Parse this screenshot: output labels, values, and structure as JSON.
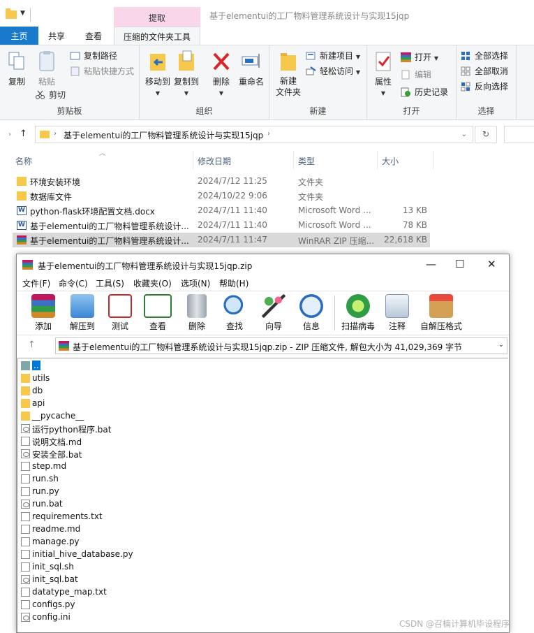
{
  "explorer": {
    "window_title": "基于elementui的工厂物料管理系统设计与实现15jqp",
    "context_tab": "提取",
    "tabs": [
      "主页",
      "共享",
      "查看",
      "压缩的文件夹工具"
    ],
    "ribbon": {
      "clipboard": {
        "label": "剪贴板",
        "copy": "复制",
        "paste": "粘贴",
        "copy_path": "复制路径",
        "paste_shortcut": "粘贴快捷方式",
        "cut": "剪切"
      },
      "organize": {
        "label": "组织",
        "move_to": "移动到",
        "copy_to": "复制到",
        "delete": "删除",
        "rename": "重命名"
      },
      "new": {
        "label": "新建",
        "new_folder": "新建\n文件夹",
        "new_item": "新建项目",
        "easy_access": "轻松访问"
      },
      "open": {
        "label": "打开",
        "properties": "属性",
        "open": "打开",
        "edit": "编辑",
        "history": "历史记录"
      },
      "select": {
        "label": "选择",
        "select_all": "全部选择",
        "select_none": "全部取消",
        "invert": "反向选择"
      }
    },
    "address": "基于elementui的工厂物料管理系统设计与实现15jqp",
    "columns": {
      "name": "名称",
      "date": "修改日期",
      "type": "类型",
      "size": "大小"
    },
    "files": [
      {
        "name": "环境安装环境",
        "date": "2024/7/12 11:25",
        "type": "文件夹",
        "size": "",
        "icon": "folder-icon"
      },
      {
        "name": "数据库文件",
        "date": "2024/10/22 9:06",
        "type": "文件夹",
        "size": "",
        "icon": "folder-icon"
      },
      {
        "name": "python-flask环境配置文档.docx",
        "date": "2024/7/11 11:40",
        "type": "Microsoft Word ...",
        "size": "13 KB",
        "icon": "word-icon"
      },
      {
        "name": "基于elementui的工厂物料管理系统设计...",
        "date": "2024/7/11 11:40",
        "type": "Microsoft Word ...",
        "size": "78 KB",
        "icon": "word-icon"
      },
      {
        "name": "基于elementui的工厂物料管理系统设计...",
        "date": "2024/7/11 11:47",
        "type": "WinRAR ZIP 压缩...",
        "size": "22,618 KB",
        "icon": "winrar-icon",
        "selected": true
      }
    ]
  },
  "winrar": {
    "title": "基于elementui的工厂物料管理系统设计与实现15jqp.zip",
    "menu": [
      "文件(F)",
      "命令(C)",
      "工具(S)",
      "收藏夹(O)",
      "选项(N)",
      "帮助(H)"
    ],
    "toolbar": [
      "添加",
      "解压到",
      "测试",
      "查看",
      "删除",
      "查找",
      "向导",
      "信息",
      "扫描病毒",
      "注释",
      "自解压格式"
    ],
    "address": "基于elementui的工厂物料管理系统设计与实现15jqp.zip - ZIP 压缩文件, 解包大小为 41,029,369 字节",
    "entries": [
      {
        "name": "..",
        "kind": "up"
      },
      {
        "name": "utils",
        "kind": "folder"
      },
      {
        "name": "db",
        "kind": "folder"
      },
      {
        "name": "api",
        "kind": "folder"
      },
      {
        "name": "__pycache__",
        "kind": "folder"
      },
      {
        "name": "运行python程序.bat",
        "kind": "bat"
      },
      {
        "name": "说明文档.md",
        "kind": "file"
      },
      {
        "name": "安装全部.bat",
        "kind": "bat"
      },
      {
        "name": "step.md",
        "kind": "file"
      },
      {
        "name": "run.sh",
        "kind": "file"
      },
      {
        "name": "run.py",
        "kind": "file"
      },
      {
        "name": "run.bat",
        "kind": "bat"
      },
      {
        "name": "requirements.txt",
        "kind": "file"
      },
      {
        "name": "readme.md",
        "kind": "file"
      },
      {
        "name": "manage.py",
        "kind": "file"
      },
      {
        "name": "initial_hive_database.py",
        "kind": "file"
      },
      {
        "name": "init_sql.sh",
        "kind": "file"
      },
      {
        "name": "init_sql.bat",
        "kind": "bat"
      },
      {
        "name": "datatype_map.txt",
        "kind": "file"
      },
      {
        "name": "configs.py",
        "kind": "file"
      },
      {
        "name": "config.ini",
        "kind": "bat"
      }
    ]
  },
  "watermark": "CSDN @召楠计算机毕设程序"
}
